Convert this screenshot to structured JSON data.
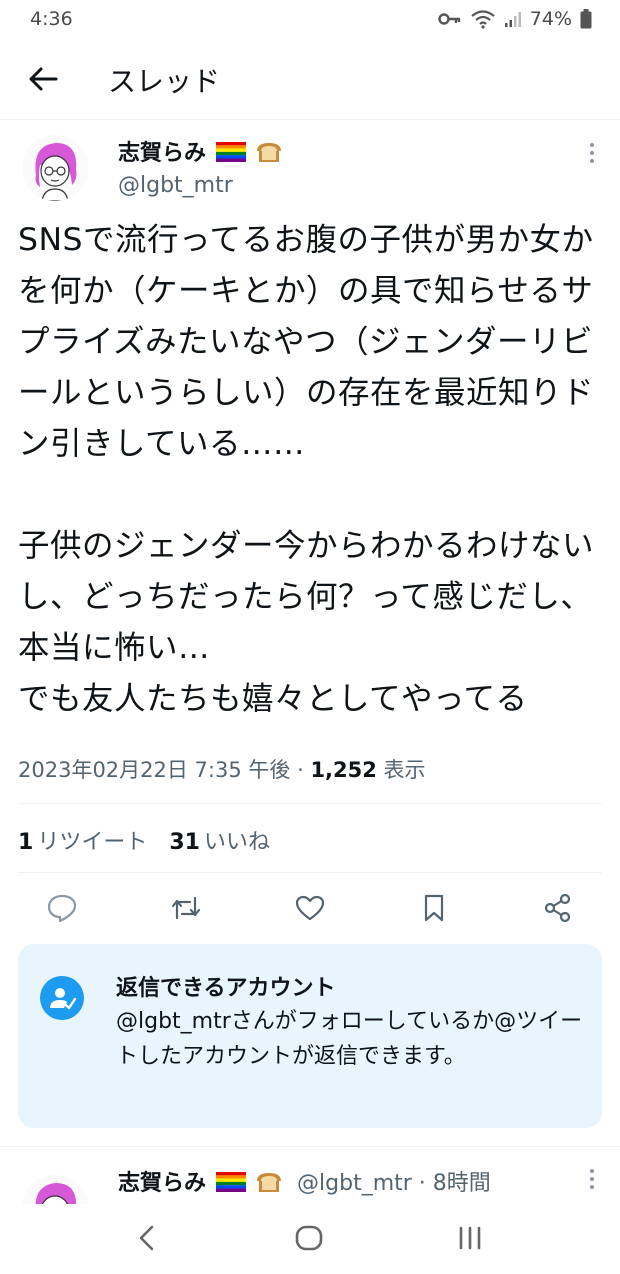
{
  "status_bar": {
    "time": "4:36",
    "battery": "74%"
  },
  "header": {
    "title": "スレッド"
  },
  "tweet": {
    "author_name": "志賀らみ",
    "author_handle": "@lgbt_mtr",
    "text": "SNSで流行ってるお腹の子供が男か女かを何か（ケーキとか）の具で知らせるサプライズみたいなやつ（ジェンダーリビールというらしい）の存在を最近知りドン引きしている……\n\n子供のジェンダー今からわかるわけないし、どっちだったら何？って感じだし、本当に怖い…\nでも友人たちも嬉々としてやってる",
    "date": "2023年02月22日 7:35 午後",
    "separator": " · ",
    "views": "1,252",
    "views_label": " 表示",
    "retweet_count": "1",
    "retweet_label": "リツイート",
    "like_count": "31",
    "like_label": "いいね"
  },
  "reply_notice": {
    "title": "返信できるアカウント",
    "description": "@lgbt_mtrさんがフォローしているか@ツイートしたアカウントが返信できます。"
  },
  "next_tweet": {
    "author_name": "志賀らみ",
    "author_handle": "@lgbt_mtr · 8時間"
  },
  "icons": {
    "back": "arrow-left-icon",
    "more": "more-vertical-icon",
    "reply": "comment-icon",
    "retweet": "retweet-icon",
    "like": "heart-icon",
    "bookmark": "bookmark-icon",
    "share": "share-icon",
    "reply_notice": "person-check-icon",
    "nav_back": "chevron-left-icon",
    "nav_home": "home-circle-icon",
    "nav_recents": "recents-icon"
  },
  "colors": {
    "accent": "#1d9bf0",
    "reply_bg": "#e8f5fd",
    "secondary_text": "#536471",
    "primary_text": "#0f1419"
  }
}
